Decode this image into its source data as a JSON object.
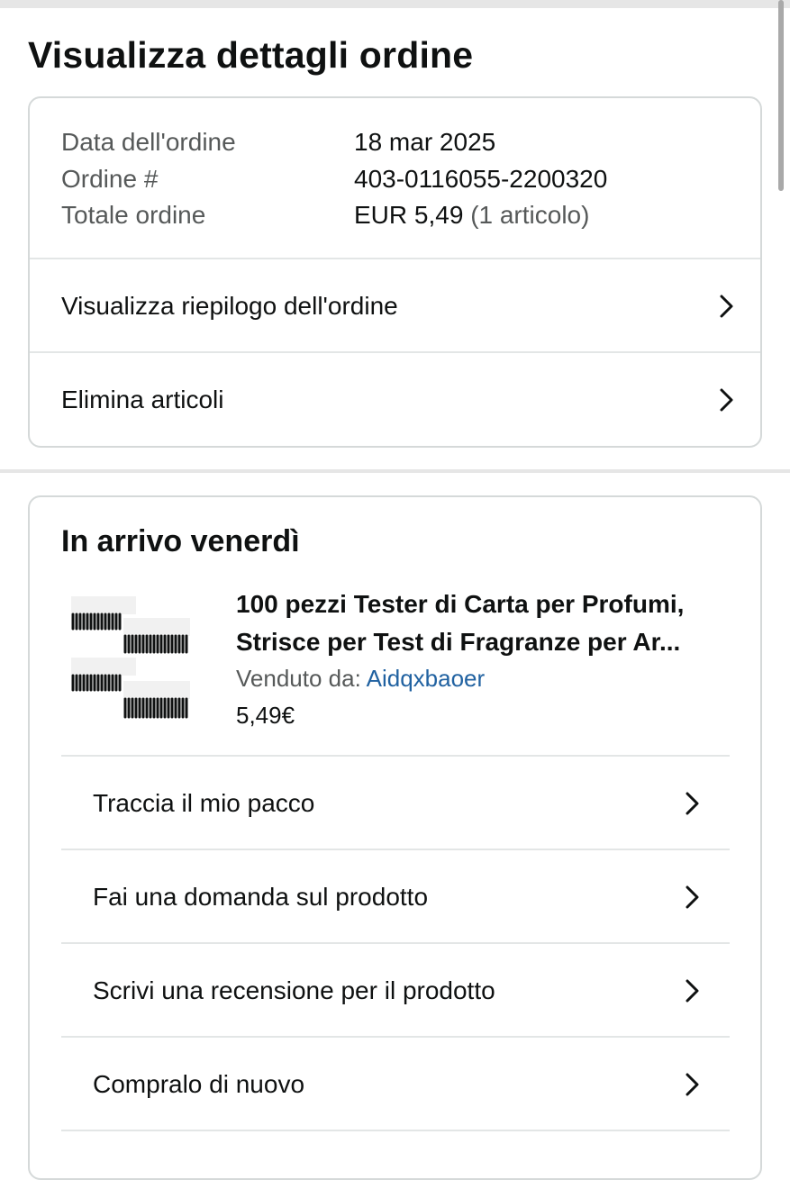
{
  "page": {
    "title": "Visualizza dettagli ordine"
  },
  "summary": {
    "date_label": "Data dell'ordine",
    "date_value": "18 mar 2025",
    "order_label": "Ordine #",
    "order_value": "403-0116055-2200320",
    "total_label": "Totale ordine",
    "total_value": "EUR 5,49",
    "total_items": "(1 articolo)",
    "links": [
      {
        "label": "Visualizza riepilogo dell'ordine",
        "icon": "chevron-right-icon"
      },
      {
        "label": "Elimina articoli",
        "icon": "chevron-right-icon"
      }
    ]
  },
  "shipment": {
    "arrival": "In arrivo venerdì",
    "product": {
      "title": "100 pezzi Tester di Carta per Profumi, Strisce per Test di Fragranze per Ar...",
      "seller_label": "Venduto da:",
      "seller_name": "Aidqxbaoer",
      "price": "5,49€"
    },
    "actions": [
      {
        "label": "Traccia il mio pacco",
        "icon": "chevron-right-icon"
      },
      {
        "label": "Fai una domanda sul prodotto",
        "icon": "chevron-right-icon"
      },
      {
        "label": "Scrivi una recensione per il prodotto",
        "icon": "chevron-right-icon"
      },
      {
        "label": "Compralo di nuovo",
        "icon": "chevron-right-icon"
      }
    ]
  },
  "colors": {
    "text": "#0f1111",
    "muted": "#565959",
    "link": "#2162a1",
    "border": "#d5d9d9"
  }
}
